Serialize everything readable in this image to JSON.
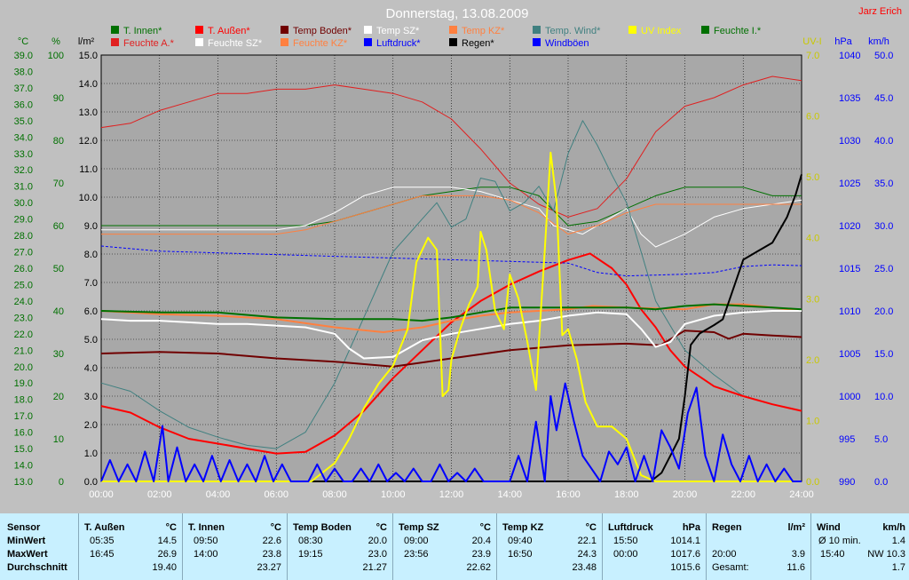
{
  "title": "Donnerstag, 13.08.2009",
  "author": "Jarz Erich",
  "colors": {
    "t_innen": "#007000",
    "t_aussen": "#ff0000",
    "temp_boden": "#700000",
    "temp_sz": "#ffffff",
    "temp_kz": "#ff8040",
    "temp_wind": "#408080",
    "uv_index": "#ffff00",
    "feuchte_i": "#007000",
    "feuchte_a": "#e02020",
    "feuchte_sz": "#ffffff",
    "feuchte_kz": "#ff8040",
    "luftdruck": "#0000ff",
    "regen": "#000000",
    "windboeen": "#0000ff"
  },
  "chart_data": {
    "type": "line",
    "title": "Donnerstag, 13.08.2009",
    "x_ticks": [
      "00:00",
      "02:00",
      "04:00",
      "06:00",
      "08:00",
      "10:00",
      "12:00",
      "14:00",
      "16:00",
      "18:00",
      "20:00",
      "22:00",
      "24:00"
    ],
    "xlim": [
      0,
      24
    ],
    "grid": true,
    "axes": {
      "celsius": {
        "label": "°C",
        "range": [
          13,
          39
        ],
        "ticks": [
          "13.0",
          "14.0",
          "15.0",
          "16.0",
          "17.0",
          "18.0",
          "19.0",
          "20.0",
          "21.0",
          "22.0",
          "23.0",
          "24.0",
          "25.0",
          "26.0",
          "27.0",
          "28.0",
          "29.0",
          "30.0",
          "31.0",
          "32.0",
          "33.0",
          "34.0",
          "35.0",
          "36.0",
          "37.0",
          "38.0",
          "39.0"
        ]
      },
      "percent": {
        "label": "%",
        "range": [
          0,
          100
        ],
        "ticks": [
          "0",
          "10",
          "20",
          "30",
          "40",
          "50",
          "60",
          "70",
          "80",
          "90",
          "100"
        ]
      },
      "rain": {
        "label": "l/m²",
        "range": [
          0,
          15
        ],
        "ticks": [
          "0.0",
          "1.0",
          "2.0",
          "3.0",
          "4.0",
          "5.0",
          "6.0",
          "7.0",
          "8.0",
          "9.0",
          "10.0",
          "11.0",
          "12.0",
          "13.0",
          "14.0",
          "15.0"
        ]
      },
      "uv": {
        "label": "UV-I",
        "range": [
          0,
          7
        ],
        "ticks": [
          "0.0",
          "1.0",
          "2.0",
          "3.0",
          "4.0",
          "5.0",
          "6.0",
          "7.0"
        ]
      },
      "hpa": {
        "label": "hPa",
        "range": [
          990,
          1040
        ],
        "ticks": [
          "990",
          "995",
          "1000",
          "1005",
          "1010",
          "1015",
          "1020",
          "1025",
          "1030",
          "1035",
          "1040"
        ]
      },
      "kmh": {
        "label": "km/h",
        "range": [
          0,
          50
        ],
        "ticks": [
          "0.0",
          "5.0",
          "10.0",
          "15.0",
          "20.0",
          "25.0",
          "30.0",
          "35.0",
          "40.0",
          "45.0",
          "50.0"
        ]
      }
    },
    "legend": [
      {
        "name": "T. Innen*",
        "key": "t_innen"
      },
      {
        "name": "T. Außen*",
        "key": "t_aussen"
      },
      {
        "name": "Temp Boden*",
        "key": "temp_boden"
      },
      {
        "name": "Temp SZ*",
        "key": "temp_sz"
      },
      {
        "name": "Temp KZ*",
        "key": "temp_kz"
      },
      {
        "name": "Temp. Wind*",
        "key": "temp_wind"
      },
      {
        "name": "UV Index",
        "key": "uv_index"
      },
      {
        "name": "Feuchte I.*",
        "key": "feuchte_i"
      },
      {
        "name": "Feuchte A.*",
        "key": "feuchte_a"
      },
      {
        "name": "Feuchte SZ*",
        "key": "feuchte_sz"
      },
      {
        "name": "Feuchte KZ*",
        "key": "feuchte_kz"
      },
      {
        "name": "Luftdruck*",
        "key": "luftdruck"
      },
      {
        "name": "Regen*",
        "key": "regen"
      },
      {
        "name": "Windböen",
        "key": "windboeen"
      }
    ],
    "series": [
      {
        "name": "Feuchte A.*",
        "key": "feuchte_a",
        "axis": "percent",
        "width": 1,
        "x": [
          0,
          1,
          2,
          3,
          4,
          5,
          6,
          7,
          8,
          9,
          10,
          11,
          12,
          13,
          14,
          15,
          16,
          17,
          18,
          19,
          20,
          21,
          22,
          23,
          24
        ],
        "values": [
          83,
          84,
          87,
          89,
          91,
          91,
          92,
          92,
          93,
          92,
          91,
          89,
          85,
          78,
          70,
          65,
          62,
          64,
          71,
          82,
          88,
          90,
          93,
          95,
          94
        ]
      },
      {
        "name": "Feuchte I.*",
        "key": "feuchte_i",
        "axis": "percent",
        "width": 1,
        "x": [
          0,
          2,
          4,
          6,
          7,
          8,
          9,
          10,
          11,
          12,
          13,
          14,
          15,
          16,
          17,
          18,
          19,
          20,
          21,
          22,
          23,
          24
        ],
        "values": [
          60,
          60,
          60,
          60,
          60,
          61,
          63,
          65,
          67,
          68,
          69,
          69,
          67,
          60,
          61,
          64,
          67,
          69,
          69,
          69,
          67,
          67
        ]
      },
      {
        "name": "Feuchte SZ*",
        "key": "feuchte_sz",
        "axis": "percent",
        "width": 1,
        "x": [
          0,
          2,
          4,
          6,
          7,
          8,
          9,
          10,
          11,
          12,
          13,
          14,
          15,
          15.5,
          16,
          16.5,
          17,
          17.5,
          18,
          18.5,
          19,
          20,
          21,
          22,
          23,
          24
        ],
        "values": [
          59,
          59,
          59,
          59,
          60,
          63,
          67,
          69,
          69,
          69,
          68,
          66,
          64,
          60,
          59,
          58,
          60,
          62,
          64,
          58,
          55,
          58,
          62,
          64,
          65,
          66
        ]
      },
      {
        "name": "Feuchte KZ*",
        "key": "feuchte_kz",
        "axis": "percent",
        "width": 1,
        "x": [
          0,
          2,
          4,
          6,
          7,
          8,
          9,
          10,
          11,
          12,
          13,
          14,
          15,
          16,
          17,
          18,
          19,
          20,
          21,
          22,
          23,
          24
        ],
        "values": [
          58,
          58,
          58,
          58,
          59,
          61,
          63,
          65,
          67,
          67,
          67,
          66,
          63,
          58,
          60,
          63,
          65,
          65,
          65,
          65,
          65,
          65
        ]
      },
      {
        "name": "Temp. Wind*",
        "key": "temp_wind",
        "axis": "celsius",
        "width": 1,
        "x": [
          0,
          1,
          2,
          3,
          4,
          5,
          6,
          7,
          8,
          9,
          10,
          11,
          11.5,
          12,
          12.5,
          13,
          13.5,
          14,
          14.5,
          15,
          15.5,
          16,
          16.5,
          17,
          17.5,
          18,
          18.5,
          19,
          20,
          21,
          22,
          23,
          24
        ],
        "values": [
          19,
          18.5,
          17.3,
          16.3,
          15.7,
          15.2,
          15,
          16,
          19,
          23,
          27,
          29,
          30,
          28.5,
          29,
          31.5,
          31.3,
          29.5,
          30,
          31,
          29.5,
          33,
          35,
          33.5,
          31.7,
          30,
          27,
          24,
          21,
          19.5,
          18.2,
          17.7,
          17.3
        ]
      },
      {
        "name": "T. Außen*",
        "key": "t_aussen",
        "axis": "celsius",
        "width": 2,
        "x": [
          0,
          1,
          2,
          3,
          4,
          5,
          6,
          7,
          8,
          9,
          10,
          11,
          12,
          13,
          14,
          15,
          16,
          16.75,
          17.5,
          18,
          18.5,
          19,
          19.5,
          20,
          21,
          22,
          23,
          24
        ],
        "values": [
          17.6,
          17.2,
          16.3,
          15.6,
          15.3,
          15,
          14.7,
          14.8,
          15.8,
          17.3,
          19.3,
          21,
          22.7,
          24,
          25,
          25.8,
          26.5,
          26.9,
          26,
          25,
          23.5,
          22.4,
          21,
          20,
          18.8,
          18.2,
          17.7,
          17.3
        ]
      },
      {
        "name": "Temp Boden*",
        "key": "temp_boden",
        "axis": "celsius",
        "width": 2,
        "x": [
          0,
          2,
          4,
          6,
          8,
          10,
          12,
          14,
          16,
          18,
          19.15,
          20,
          21,
          21.5,
          22,
          23,
          24
        ],
        "values": [
          20.8,
          20.9,
          20.8,
          20.5,
          20.3,
          20,
          20.5,
          21,
          21.3,
          21.4,
          21.3,
          22.2,
          22.1,
          21.7,
          22.0,
          21.9,
          21.8
        ]
      },
      {
        "name": "Temp KZ*",
        "key": "temp_kz",
        "axis": "celsius",
        "width": 2,
        "x": [
          0,
          2,
          4,
          6,
          8,
          9.67,
          11,
          12,
          13,
          14,
          16,
          16.83,
          18,
          20,
          21,
          22,
          23,
          24
        ],
        "values": [
          23.4,
          23.2,
          23.1,
          22.9,
          22.4,
          22.1,
          22.4,
          22.8,
          23.1,
          23.3,
          23.5,
          23.7,
          23.6,
          23.5,
          23.8,
          23.8,
          23.6,
          23.4
        ]
      },
      {
        "name": "Temp SZ*",
        "key": "temp_sz",
        "axis": "celsius",
        "width": 2,
        "x": [
          0,
          1,
          2,
          3,
          4,
          5,
          6,
          7,
          8,
          8.5,
          9,
          10,
          11,
          12,
          13,
          14,
          15,
          16,
          17,
          18,
          18.5,
          19,
          19.5,
          20,
          21,
          22,
          23,
          24
        ],
        "values": [
          22.9,
          22.8,
          22.8,
          22.7,
          22.6,
          22.6,
          22.5,
          22.4,
          22.0,
          21.1,
          20.5,
          20.6,
          21.6,
          22,
          22.3,
          22.6,
          22.8,
          23.1,
          23.3,
          23.2,
          22.3,
          21.2,
          21.5,
          22.6,
          23.1,
          23.3,
          23.4,
          23.4
        ]
      },
      {
        "name": "T. Innen*",
        "key": "t_innen",
        "axis": "celsius",
        "width": 2,
        "x": [
          0,
          2,
          4,
          6,
          8,
          10,
          11,
          12,
          13,
          14,
          15,
          16,
          17,
          18,
          19,
          20,
          21,
          22,
          23,
          24
        ],
        "values": [
          23.4,
          23.3,
          23.3,
          23.0,
          22.9,
          22.9,
          22.8,
          23.0,
          23.3,
          23.6,
          23.6,
          23.6,
          23.6,
          23.6,
          23.5,
          23.7,
          23.8,
          23.7,
          23.6,
          23.5
        ]
      },
      {
        "name": "Luftdruck*",
        "key": "luftdruck",
        "axis": "hpa",
        "width": 1,
        "dash": true,
        "x": [
          0,
          2,
          4,
          6,
          8,
          10,
          12,
          14,
          16,
          17,
          18,
          19,
          20,
          21,
          22,
          23,
          24
        ],
        "values": [
          1017.6,
          1017.0,
          1016.8,
          1016.6,
          1016.4,
          1016.2,
          1016.0,
          1015.8,
          1015.6,
          1014.5,
          1014.1,
          1014.2,
          1014.3,
          1014.5,
          1015.2,
          1015.4,
          1015.3
        ]
      },
      {
        "name": "Regen*",
        "key": "regen",
        "axis": "rain",
        "width": 2,
        "x": [
          0,
          18.83,
          19.2,
          19.5,
          19.8,
          20.0,
          20.2,
          20.5,
          21.0,
          21.3,
          21.5,
          22.0,
          22.5,
          23.0,
          23.5,
          23.8,
          24.0
        ],
        "values": [
          0,
          0,
          0.3,
          0.9,
          1.5,
          3.0,
          4.8,
          5.2,
          5.5,
          5.7,
          6.3,
          7.8,
          8.1,
          8.4,
          9.3,
          10.1,
          10.8
        ]
      },
      {
        "name": "UV Index",
        "key": "uv_index",
        "axis": "uv",
        "width": 2,
        "x": [
          0,
          7.2,
          8,
          8.5,
          9,
          9.5,
          10,
          10.5,
          10.8,
          11,
          11.2,
          11.5,
          11.7,
          11.9,
          12,
          12.3,
          12.6,
          12.9,
          13,
          13.2,
          13.5,
          13.8,
          14,
          14.3,
          14.6,
          14.9,
          15,
          15.2,
          15.4,
          15.6,
          15.8,
          16,
          16.3,
          16.6,
          16.8,
          17,
          17.5,
          18,
          18.5,
          19,
          24
        ],
        "values": [
          0,
          0,
          0.3,
          0.7,
          1.2,
          1.6,
          1.9,
          2.5,
          3.6,
          3.8,
          4.0,
          3.8,
          1.4,
          1.5,
          2.0,
          2.5,
          2.9,
          3.2,
          4.1,
          3.8,
          2.8,
          2.5,
          3.4,
          3.0,
          2.3,
          1.5,
          2.3,
          3.8,
          5.4,
          4.6,
          2.4,
          2.5,
          2.0,
          1.3,
          1.1,
          0.9,
          0.9,
          0.7,
          0.1,
          0,
          0
        ]
      },
      {
        "name": "Windböen",
        "key": "windboeen",
        "axis": "kmh",
        "width": 2,
        "x": [
          0,
          0.3,
          0.6,
          0.9,
          1.2,
          1.5,
          1.8,
          2.1,
          2.3,
          2.6,
          2.9,
          3.2,
          3.5,
          3.8,
          4.1,
          4.4,
          4.7,
          5,
          5.3,
          5.6,
          5.9,
          6.2,
          6.5,
          6.8,
          7.1,
          7.4,
          7.7,
          8,
          8.3,
          8.6,
          8.9,
          9.2,
          9.5,
          9.8,
          10.1,
          10.4,
          10.7,
          11,
          11.3,
          11.6,
          11.9,
          12.2,
          12.5,
          12.8,
          13.1,
          13.4,
          13.7,
          14,
          14.3,
          14.6,
          14.9,
          15.2,
          15.4,
          15.6,
          15.9,
          16.2,
          16.5,
          16.8,
          17.1,
          17.4,
          17.7,
          18,
          18.3,
          18.6,
          18.9,
          19.2,
          19.5,
          19.8,
          20.1,
          20.4,
          20.7,
          21,
          21.3,
          21.6,
          21.9,
          22.2,
          22.5,
          22.8,
          23.1,
          23.4,
          23.7,
          24
        ],
        "values": [
          0,
          2.5,
          0,
          2.0,
          0,
          3.5,
          0,
          6.5,
          0,
          4.0,
          0,
          2.0,
          0,
          3.0,
          0,
          2.5,
          0,
          2.0,
          0,
          3.0,
          0,
          2.0,
          0,
          0,
          0,
          2.0,
          0,
          1.5,
          0,
          0,
          1.5,
          0,
          2.0,
          0,
          1.0,
          0,
          1.5,
          0,
          0,
          2.0,
          0,
          1.0,
          0,
          1.5,
          0,
          0,
          0,
          0,
          3.0,
          0,
          7.0,
          0,
          10.0,
          6.0,
          11.5,
          7.0,
          3.0,
          1.5,
          0,
          3.5,
          2.0,
          4.0,
          0,
          3.0,
          0,
          6.0,
          4.0,
          1.5,
          8.0,
          11.0,
          3.0,
          0,
          5.5,
          2.0,
          0,
          3.0,
          0,
          2.0,
          0,
          1.5,
          0,
          0
        ]
      }
    ]
  },
  "stats": {
    "row_labels": [
      "Sensor",
      "MinWert",
      "MaxWert",
      "Durchschnitt"
    ],
    "columns": [
      {
        "name": "T. Außen",
        "unit": "°C",
        "min_time": "05:35",
        "min": "14.5",
        "max_time": "16:45",
        "max": "26.9",
        "avg": "19.40"
      },
      {
        "name": "T. Innen",
        "unit": "°C",
        "min_time": "09:50",
        "min": "22.6",
        "max_time": "14:00",
        "max": "23.8",
        "avg": "23.27"
      },
      {
        "name": "Temp Boden",
        "unit": "°C",
        "min_time": "08:30",
        "min": "20.0",
        "max_time": "19:15",
        "max": "23.0",
        "avg": "21.27"
      },
      {
        "name": "Temp SZ",
        "unit": "°C",
        "min_time": "09:00",
        "min": "20.4",
        "max_time": "23:56",
        "max": "23.9",
        "avg": "22.62"
      },
      {
        "name": "Temp KZ",
        "unit": "°C",
        "min_time": "09:40",
        "min": "22.1",
        "max_time": "16:50",
        "max": "24.3",
        "avg": "23.48"
      },
      {
        "name": "Luftdruck",
        "unit": "hPa",
        "min_time": "15:50",
        "min": "1014.1",
        "max_time": "00:00",
        "max": "1017.6",
        "avg": "1015.6"
      }
    ],
    "regen": {
      "name": "Regen",
      "unit": "l/m²",
      "min_time": "20:00",
      "min": "3.9",
      "avg_label": "Gesamt:",
      "avg": "11.6"
    },
    "wind": {
      "name": "Wind",
      "unit": "km/h",
      "min_time": "Ø 10 min.",
      "min": "1.4",
      "max_time": "15:40",
      "max": "NW 10.3",
      "avg": "1.7"
    }
  }
}
